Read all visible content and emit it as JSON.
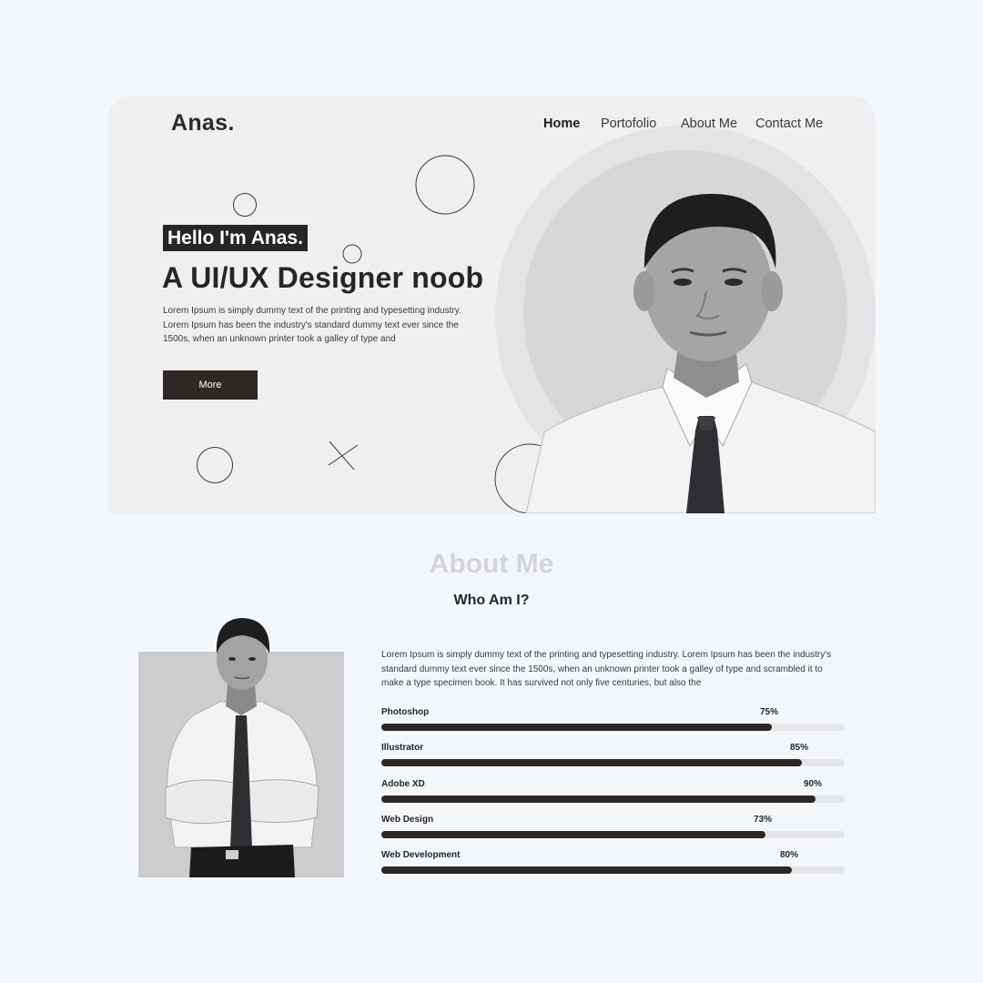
{
  "brand": "Anas.",
  "nav": {
    "items": [
      {
        "label": "Home",
        "active": true
      },
      {
        "label": "Portofolio",
        "active": false
      },
      {
        "label": "About Me",
        "active": false
      },
      {
        "label": "Contact Me",
        "active": false
      }
    ]
  },
  "hero": {
    "badge": "Hello I'm Anas.",
    "headline": "A UI/UX Designer noob",
    "description": "Lorem Ipsum is simply dummy text of the printing and typesetting industry. Lorem Ipsum has been the industry's standard dummy text ever since the 1500s, when an unknown printer took a galley of type and",
    "button_label": "More"
  },
  "about": {
    "title": "About Me",
    "subtitle": "Who Am I?",
    "description": "Lorem Ipsum is simply dummy text of the printing and typesetting industry. Lorem Ipsum has been the industry's standard dummy text ever since the 1500s, when an unknown printer took a galley of type and scrambled it to make a type specimen book. It has survived not only five centuries, but also the",
    "skills": [
      {
        "name": "Photoshop",
        "percent_label": "75%",
        "level": 0.843
      },
      {
        "name": "Illustrator",
        "percent_label": "85%",
        "level": 0.907
      },
      {
        "name": "Adobe XD",
        "percent_label": "90%",
        "level": 0.938
      },
      {
        "name": "Web Design",
        "percent_label": "73%",
        "level": 0.829
      },
      {
        "name": "Web Development",
        "percent_label": "80%",
        "level": 0.887
      }
    ]
  },
  "colors": {
    "page_bg": "#f4f7fa",
    "hero_bg": "#efeff1",
    "accent_dark": "#2d2826",
    "muted_title": "#d4d4d6"
  }
}
